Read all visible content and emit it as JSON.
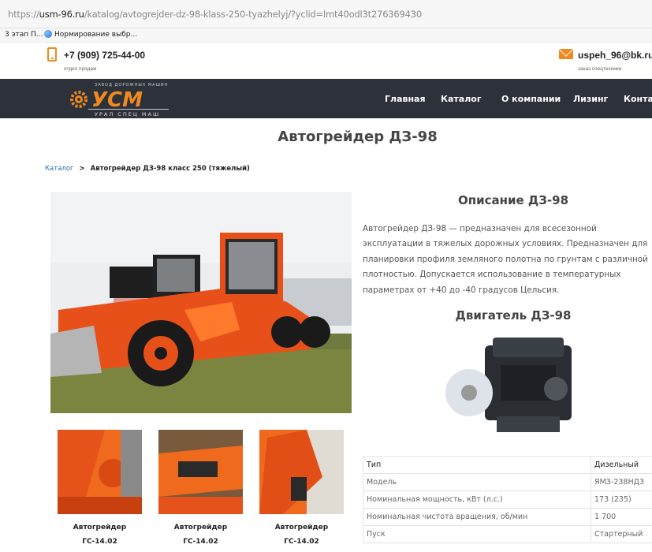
{
  "browser": {
    "url_prefix": "https://",
    "url_domain": "usm-96.ru",
    "url_path": "/katalog/avtogrejder-dz-98-klass-250-tyazhelyj/?yclid=lmt40odl3t276369430",
    "bookmarks": [
      {
        "label": "3 этап П..."
      },
      {
        "label": "Нормирование выбр..."
      }
    ]
  },
  "header": {
    "phone": "+7 (909) 725-44-00",
    "phone_sub": "отдел продаж",
    "email": "uspeh_96@bk.ru",
    "email_sub": "заказ спецтехники"
  },
  "logo": {
    "top_text": "ЗАВОД ДОРОЖНЫХ МАШИН",
    "main_text": "УСМ",
    "bottom_text": "УРАЛ СПЕЦ МАШ"
  },
  "nav": {
    "items": [
      {
        "label": "Главная"
      },
      {
        "label": "Каталог"
      },
      {
        "label": "О компании"
      },
      {
        "label": "Лизинг"
      },
      {
        "label": "Контакты"
      }
    ]
  },
  "page": {
    "title": "Автогрейдер ДЗ-98",
    "breadcrumb": {
      "root": "Каталог",
      "sep": ">",
      "current": "Автогрейдер ДЗ-98 класс 250 (тяжелый)"
    }
  },
  "thumbs": [
    {
      "line1": "Автогрейдер",
      "line2": "ГС-14.02"
    },
    {
      "line1": "Автогрейдер",
      "line2": "ГС-14.02"
    },
    {
      "line1": "Автогрейдер",
      "line2": "ГС-14.02"
    }
  ],
  "description": {
    "heading": "Описание ДЗ-98",
    "text": "Автогрейдер ДЗ-98 — предназначен для всесезонной эксплуатации в тяжелых дорожных условиях. Предназначен для планировки профиля земляного полотна по грунтам с различной плотностью. Допускается использование в температурных параметрах от +40 до -40 градусов Цельсия."
  },
  "engine": {
    "heading": "Двигатель ДЗ-98"
  },
  "spec_table": [
    {
      "name": "Тип",
      "value": "Дизельный"
    },
    {
      "name": "Модель",
      "value": "ЯМЗ-238НД3"
    },
    {
      "name": "Номинальная мощность, кВт (л.с.)",
      "value": "173 (235)"
    },
    {
      "name": "Номинальная чистота вращения, об/мин",
      "value": "1 700"
    },
    {
      "name": "Пуск",
      "value": "Стартерный"
    }
  ],
  "colors": {
    "accent": "#f0891e",
    "nav_bg": "#2c313a",
    "link": "#2a6db3"
  }
}
